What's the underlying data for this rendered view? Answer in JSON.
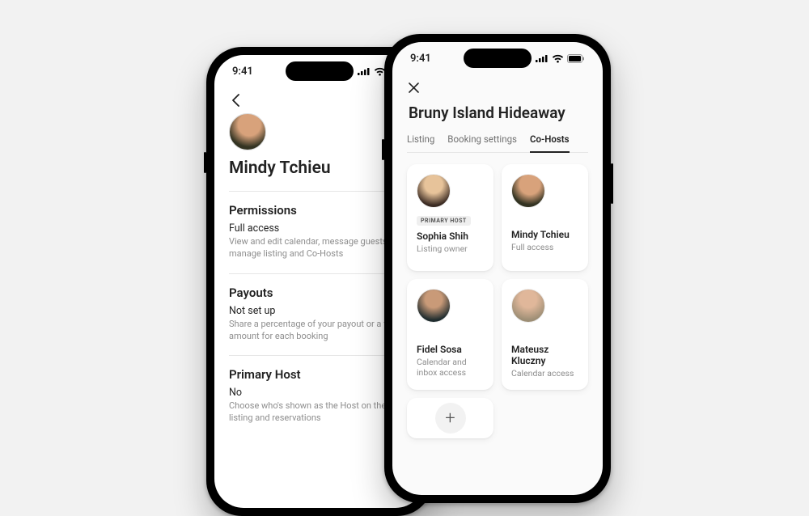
{
  "status": {
    "time": "9:41"
  },
  "left_phone": {
    "user_name": "Mindy Tchieu",
    "sections": {
      "permissions": {
        "heading": "Permissions",
        "value": "Full access",
        "desc": "View and edit calendar, message guests, manage listing and Co-Hosts"
      },
      "payouts": {
        "heading": "Payouts",
        "value": "Not set up",
        "desc": "Share a percentage of your payout or a fixed amount for each booking"
      },
      "primary_host": {
        "heading": "Primary Host",
        "value": "No",
        "desc": "Choose who's shown as the Host on the listing and reservations"
      }
    }
  },
  "right_phone": {
    "title": "Bruny Island Hideaway",
    "tabs": [
      {
        "label": "Listing",
        "active": false
      },
      {
        "label": "Booking settings",
        "active": false
      },
      {
        "label": "Co-Hosts",
        "active": true
      }
    ],
    "hosts": [
      {
        "name": "Sophia Shih",
        "role": "Listing owner",
        "badge": "PRIMARY HOST",
        "avatar": "av-sophia"
      },
      {
        "name": "Mindy Tchieu",
        "role": "Full access",
        "badge": null,
        "avatar": "av-mindy"
      },
      {
        "name": "Fidel Sosa",
        "role": "Calendar and inbox access",
        "badge": null,
        "avatar": "av-fidel"
      },
      {
        "name": "Mateusz Kluczny",
        "role": "Calendar access",
        "badge": null,
        "avatar": "av-mateusz"
      }
    ]
  }
}
